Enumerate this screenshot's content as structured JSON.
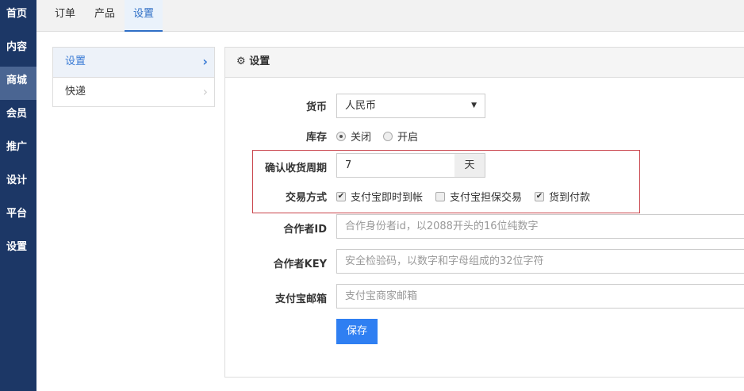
{
  "sidebar": {
    "items": [
      {
        "label": "首页"
      },
      {
        "label": "内容"
      },
      {
        "label": "商城"
      },
      {
        "label": "会员"
      },
      {
        "label": "推广"
      },
      {
        "label": "设计"
      },
      {
        "label": "平台"
      },
      {
        "label": "设置"
      }
    ],
    "active": "商城"
  },
  "tabs": [
    {
      "label": "订单"
    },
    {
      "label": "产品"
    },
    {
      "label": "设置"
    }
  ],
  "submenu": [
    {
      "label": "设置"
    },
    {
      "label": "快递"
    }
  ],
  "panel": {
    "title": "设置",
    "icon": "gear-icon"
  },
  "form": {
    "currency": {
      "label": "货币",
      "value": "人民币"
    },
    "stock": {
      "label": "库存",
      "options": [
        "关闭",
        "开启"
      ],
      "selected": "关闭"
    },
    "confirm_period": {
      "label": "确认收货周期",
      "value": "7",
      "unit": "天"
    },
    "trade": {
      "label": "交易方式",
      "options": [
        {
          "label": "支付宝即时到帐",
          "checked": true
        },
        {
          "label": "支付宝担保交易",
          "checked": false
        },
        {
          "label": "货到付款",
          "checked": true
        }
      ]
    },
    "partner_id": {
      "label": "合作者ID",
      "placeholder": "合作身份者id，以2088开头的16位纯数字"
    },
    "partner_key": {
      "label": "合作者KEY",
      "placeholder": "安全检验码，以数字和字母组成的32位字符"
    },
    "alipay_email": {
      "label": "支付宝邮箱",
      "placeholder": "支付宝商家邮箱"
    },
    "save_label": "保存"
  }
}
